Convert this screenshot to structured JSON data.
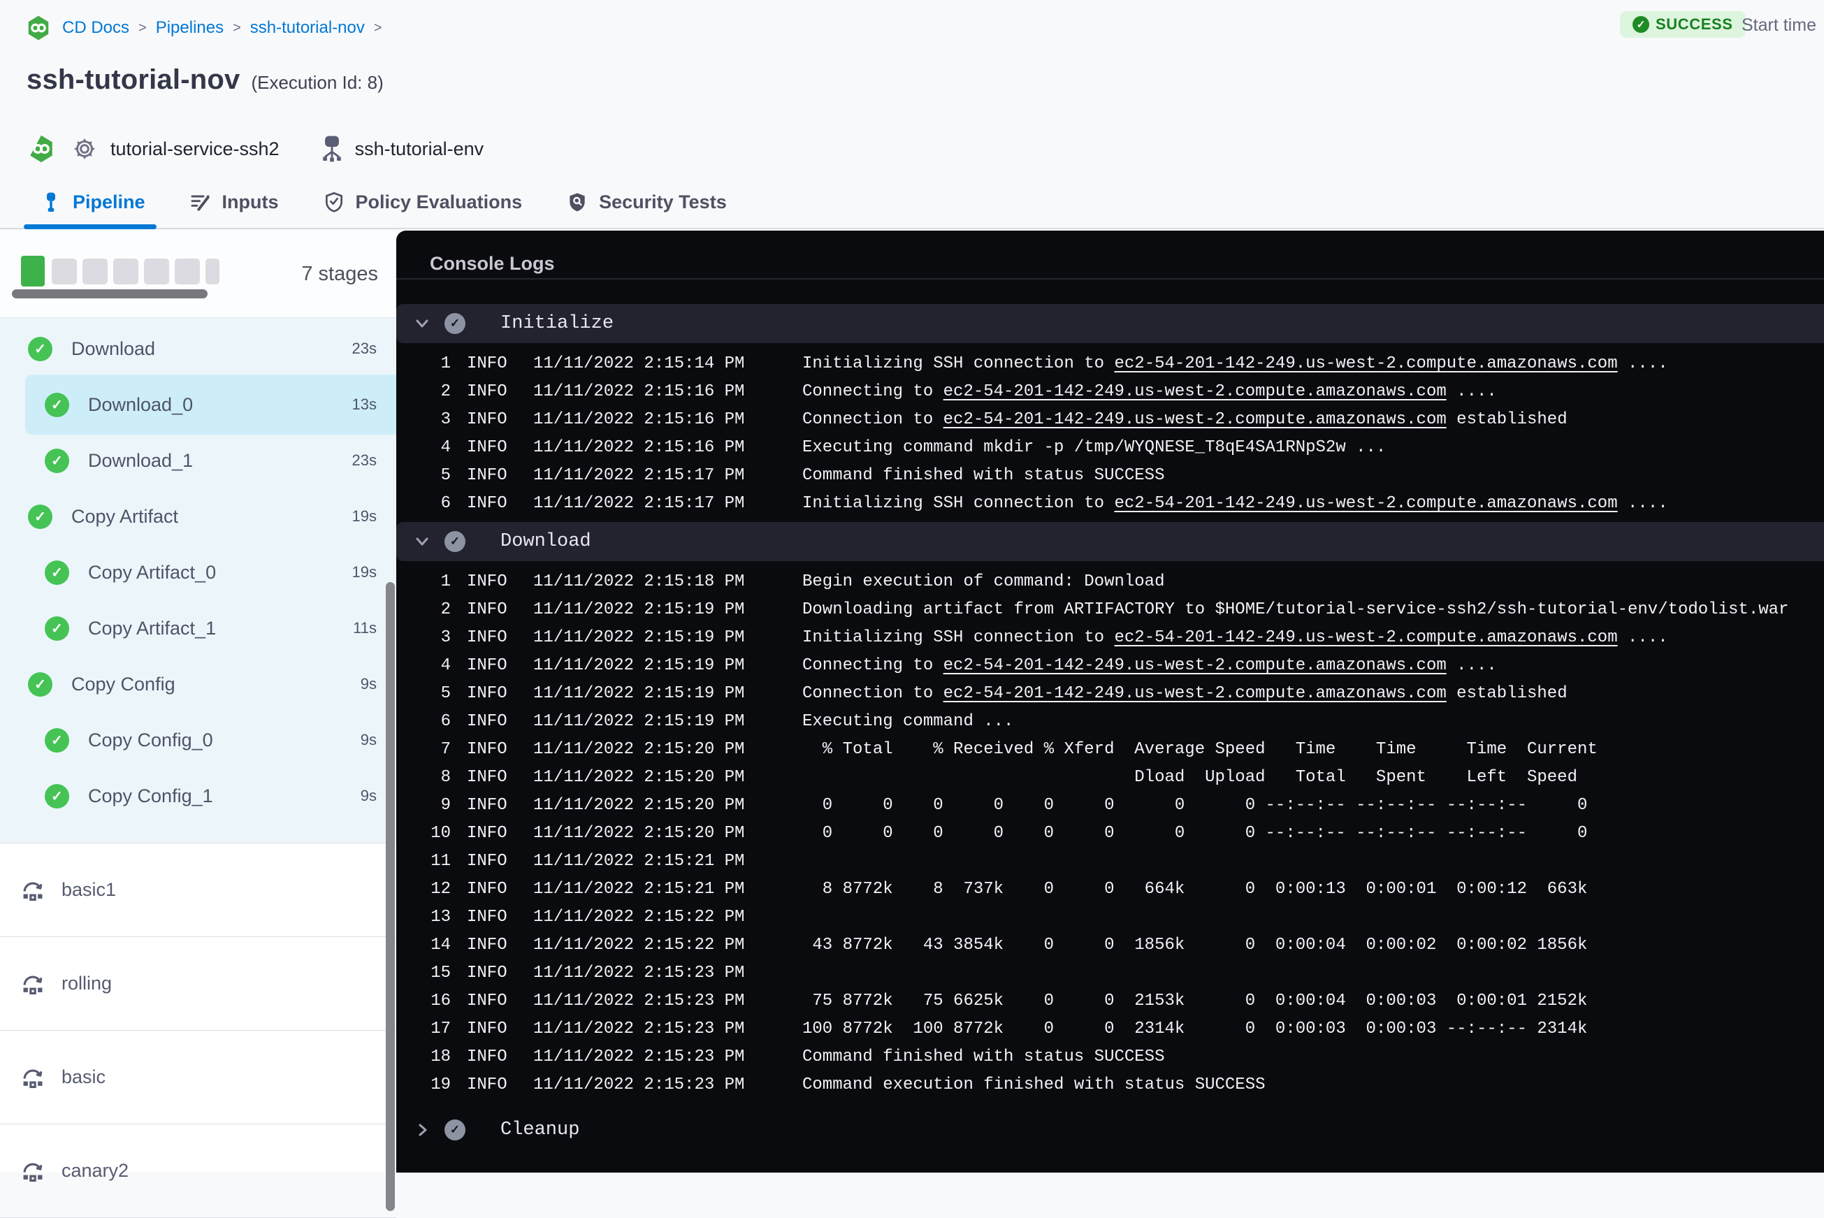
{
  "breadcrumb": {
    "items": [
      "CD Docs",
      "Pipelines",
      "ssh-tutorial-nov"
    ],
    "sep": ">"
  },
  "header": {
    "title": "ssh-tutorial-nov",
    "execution_id": "(Execution Id: 8)",
    "service": "tutorial-service-ssh2",
    "environment": "ssh-tutorial-env"
  },
  "status": {
    "label": "SUCCESS",
    "start_time_label": "Start time"
  },
  "tabs": [
    {
      "label": "Pipeline",
      "active": true
    },
    {
      "label": "Inputs",
      "active": false
    },
    {
      "label": "Policy Evaluations",
      "active": false
    },
    {
      "label": "Security Tests",
      "active": false
    }
  ],
  "stages": {
    "count_label": "7 stages",
    "items": [
      {
        "name": "Download",
        "duration": "23s",
        "level": 0,
        "selected": false
      },
      {
        "name": "Download_0",
        "duration": "13s",
        "level": 1,
        "selected": true
      },
      {
        "name": "Download_1",
        "duration": "23s",
        "level": 1,
        "selected": false
      },
      {
        "name": "Copy Artifact",
        "duration": "19s",
        "level": 0,
        "selected": false
      },
      {
        "name": "Copy Artifact_0",
        "duration": "19s",
        "level": 1,
        "selected": false
      },
      {
        "name": "Copy Artifact_1",
        "duration": "11s",
        "level": 1,
        "selected": false
      },
      {
        "name": "Copy Config",
        "duration": "9s",
        "level": 0,
        "selected": false
      },
      {
        "name": "Copy Config_0",
        "duration": "9s",
        "level": 1,
        "selected": false
      },
      {
        "name": "Copy Config_1",
        "duration": "9s",
        "level": 1,
        "selected": false
      }
    ],
    "rollback_items": [
      "basic1",
      "rolling",
      "basic",
      "canary2"
    ]
  },
  "console": {
    "title": "Console Logs",
    "sections": [
      {
        "name": "Initialize",
        "collapsed": false,
        "lines": [
          {
            "n": "1",
            "lvl": "INFO",
            "t": "11/11/2022 2:15:14 PM",
            "m": "Initializing SSH connection to ec2-54-201-142-249.us-west-2.compute.amazonaws.com ...."
          },
          {
            "n": "2",
            "lvl": "INFO",
            "t": "11/11/2022 2:15:16 PM",
            "m": "Connecting to ec2-54-201-142-249.us-west-2.compute.amazonaws.com ...."
          },
          {
            "n": "3",
            "lvl": "INFO",
            "t": "11/11/2022 2:15:16 PM",
            "m": "Connection to ec2-54-201-142-249.us-west-2.compute.amazonaws.com established"
          },
          {
            "n": "4",
            "lvl": "INFO",
            "t": "11/11/2022 2:15:16 PM",
            "m": "Executing command mkdir -p /tmp/WYQNESE_T8qE4SA1RNpS2w ..."
          },
          {
            "n": "5",
            "lvl": "INFO",
            "t": "11/11/2022 2:15:17 PM",
            "m": "Command finished with status SUCCESS"
          },
          {
            "n": "6",
            "lvl": "INFO",
            "t": "11/11/2022 2:15:17 PM",
            "m": "Initializing SSH connection to ec2-54-201-142-249.us-west-2.compute.amazonaws.com ...."
          }
        ]
      },
      {
        "name": "Download",
        "collapsed": false,
        "lines": [
          {
            "n": "1",
            "lvl": "INFO",
            "t": "11/11/2022 2:15:18 PM",
            "m": "Begin execution of command: Download"
          },
          {
            "n": "2",
            "lvl": "INFO",
            "t": "11/11/2022 2:15:19 PM",
            "m": "Downloading artifact from ARTIFACTORY to $HOME/tutorial-service-ssh2/ssh-tutorial-env/todolist.war"
          },
          {
            "n": "3",
            "lvl": "INFO",
            "t": "11/11/2022 2:15:19 PM",
            "m": "Initializing SSH connection to ec2-54-201-142-249.us-west-2.compute.amazonaws.com ...."
          },
          {
            "n": "4",
            "lvl": "INFO",
            "t": "11/11/2022 2:15:19 PM",
            "m": "Connecting to ec2-54-201-142-249.us-west-2.compute.amazonaws.com ...."
          },
          {
            "n": "5",
            "lvl": "INFO",
            "t": "11/11/2022 2:15:19 PM",
            "m": "Connection to ec2-54-201-142-249.us-west-2.compute.amazonaws.com established"
          },
          {
            "n": "6",
            "lvl": "INFO",
            "t": "11/11/2022 2:15:19 PM",
            "m": "Executing command ..."
          },
          {
            "n": "7",
            "lvl": "INFO",
            "t": "11/11/2022 2:15:20 PM",
            "m": "  % Total    % Received % Xferd  Average Speed   Time    Time     Time  Current"
          },
          {
            "n": "8",
            "lvl": "INFO",
            "t": "11/11/2022 2:15:20 PM",
            "m": "                                 Dload  Upload   Total   Spent    Left  Speed"
          },
          {
            "n": "9",
            "lvl": "INFO",
            "t": "11/11/2022 2:15:20 PM",
            "m": "  0     0    0     0    0     0      0      0 --:--:-- --:--:-- --:--:--     0"
          },
          {
            "n": "10",
            "lvl": "INFO",
            "t": "11/11/2022 2:15:20 PM",
            "m": "  0     0    0     0    0     0      0      0 --:--:-- --:--:-- --:--:--     0"
          },
          {
            "n": "11",
            "lvl": "INFO",
            "t": "11/11/2022 2:15:21 PM",
            "m": ""
          },
          {
            "n": "12",
            "lvl": "INFO",
            "t": "11/11/2022 2:15:21 PM",
            "m": "  8 8772k    8  737k    0     0   664k      0  0:00:13  0:00:01  0:00:12  663k"
          },
          {
            "n": "13",
            "lvl": "INFO",
            "t": "11/11/2022 2:15:22 PM",
            "m": ""
          },
          {
            "n": "14",
            "lvl": "INFO",
            "t": "11/11/2022 2:15:22 PM",
            "m": " 43 8772k   43 3854k    0     0  1856k      0  0:00:04  0:00:02  0:00:02 1856k"
          },
          {
            "n": "15",
            "lvl": "INFO",
            "t": "11/11/2022 2:15:23 PM",
            "m": ""
          },
          {
            "n": "16",
            "lvl": "INFO",
            "t": "11/11/2022 2:15:23 PM",
            "m": " 75 8772k   75 6625k    0     0  2153k      0  0:00:04  0:00:03  0:00:01 2152k"
          },
          {
            "n": "17",
            "lvl": "INFO",
            "t": "11/11/2022 2:15:23 PM",
            "m": "100 8772k  100 8772k    0     0  2314k      0  0:00:03  0:00:03 --:--:-- 2314k"
          },
          {
            "n": "18",
            "lvl": "INFO",
            "t": "11/11/2022 2:15:23 PM",
            "m": "Command finished with status SUCCESS"
          },
          {
            "n": "19",
            "lvl": "INFO",
            "t": "11/11/2022 2:15:23 PM",
            "m": "Command execution finished with status SUCCESS"
          }
        ]
      },
      {
        "name": "Cleanup",
        "collapsed": true,
        "lines": []
      }
    ]
  },
  "colors": {
    "accent_blue": "#0278d5",
    "success_green": "#45c355",
    "badge_bg": "#ddf5de",
    "badge_text": "#188021",
    "selected_row": "#cdeef9",
    "console_bg": "#0a0b0e",
    "section_bar": "#22232e"
  }
}
